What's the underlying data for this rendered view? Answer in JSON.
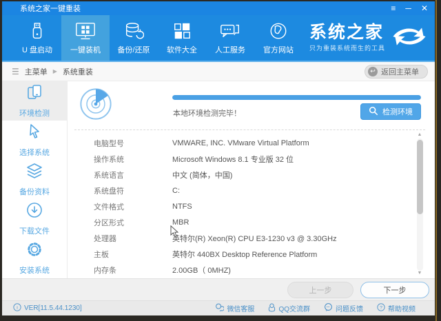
{
  "window": {
    "title": "系统之家一键重装"
  },
  "nav": {
    "items": [
      {
        "label": "U 盘启动"
      },
      {
        "label": "一键装机"
      },
      {
        "label": "备份/还原"
      },
      {
        "label": "软件大全"
      },
      {
        "label": "人工服务"
      },
      {
        "label": "官方网站"
      }
    ],
    "brand": {
      "name": "系统之家",
      "tagline": "只为重装系统而生的工具"
    }
  },
  "breadcrumb": {
    "root": "主菜单",
    "current": "系统重装",
    "back_button": "返回主菜单"
  },
  "sidebar": {
    "items": [
      {
        "label": "环境检测"
      },
      {
        "label": "选择系统"
      },
      {
        "label": "备份资料"
      },
      {
        "label": "下载文件"
      },
      {
        "label": "安装系统"
      }
    ]
  },
  "main": {
    "progress_percent": 100,
    "status_text": "本地环境检测完毕！",
    "detect_button": "检测环境",
    "info_rows": [
      {
        "label": "电脑型号",
        "value": "VMWARE, INC. VMware Virtual Platform"
      },
      {
        "label": "操作系统",
        "value": "Microsoft Windows 8.1 专业版 32 位"
      },
      {
        "label": "系统语言",
        "value": "中文 (简体，中国)"
      },
      {
        "label": "系统盘符",
        "value": "C:"
      },
      {
        "label": "文件格式",
        "value": "NTFS"
      },
      {
        "label": "分区形式",
        "value": "MBR"
      },
      {
        "label": "处理器",
        "value": "英特尔(R) Xeon(R) CPU E3-1230 v3 @ 3.30GHz"
      },
      {
        "label": "主板",
        "value": "英特尔 440BX Desktop Reference Platform"
      },
      {
        "label": "内存条",
        "value": "2.00GB（ 0MHZ)"
      }
    ],
    "more_indicator": "⋯"
  },
  "pager": {
    "prev": "上一步",
    "next": "下一步"
  },
  "footer": {
    "version": "VER[11.5.44.1230]",
    "links": [
      {
        "label": "微信客服"
      },
      {
        "label": "QQ交流群"
      },
      {
        "label": "问题反馈"
      },
      {
        "label": "帮助视频"
      }
    ]
  },
  "colors": {
    "titlebar_blue": "#1b85e2",
    "nav_blue": "#1d8ae0",
    "accent_blue": "#51a6e8",
    "link_blue": "#4a90c8"
  }
}
